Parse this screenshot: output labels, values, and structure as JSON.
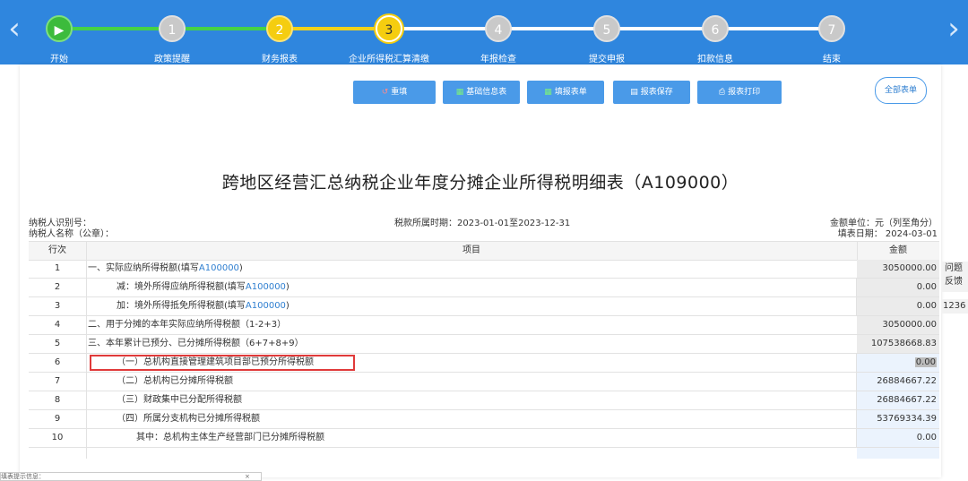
{
  "nav": {
    "prev_icon": "chevron-left-icon",
    "next_icon": "chevron-right-icon",
    "prev_glyph": "‹",
    "next_glyph": "›"
  },
  "steps": [
    {
      "label": "开始",
      "number": "▶",
      "state": "done"
    },
    {
      "label": "政策提醒",
      "number": "1",
      "state": "todo"
    },
    {
      "label": "财务报表",
      "number": "2",
      "state": "done-yellow"
    },
    {
      "label": "企业所得税汇算清缴",
      "number": "3",
      "state": "current"
    },
    {
      "label": "年报检查",
      "number": "4",
      "state": "todo"
    },
    {
      "label": "提交申报",
      "number": "5",
      "state": "todo"
    },
    {
      "label": "扣款信息",
      "number": "6",
      "state": "todo"
    },
    {
      "label": "结束",
      "number": "7",
      "state": "todo"
    }
  ],
  "toolbar": {
    "reset": {
      "icon": "↺",
      "label": "重填"
    },
    "basic_info": {
      "icon": "▦",
      "label": "基础信息表"
    },
    "fill_form": {
      "icon": "▦",
      "label": "填报表单"
    },
    "save": {
      "icon": "▤",
      "label": "报表保存"
    },
    "print": {
      "icon": "⎙",
      "label": "报表打印"
    },
    "all_forms": "全部表单"
  },
  "report": {
    "title": "跨地区经营汇总纳税企业年度分摊企业所得税明细表（A109000）",
    "taxpayer_id_label": "纳税人识别号：",
    "taxpayer_name_label": "纳税人名称（公章）：",
    "period": "税款所属时期：2023-01-01至2023-12-31",
    "unit": "金额单位：元（列至角分）",
    "fill_date": "填表日期： 2024-03-01"
  },
  "table": {
    "headers": {
      "no": "行次",
      "item": "项目",
      "amount": "金额"
    },
    "rows": [
      {
        "no": "1",
        "pre": "一、实际应纳所得税额(填写",
        "link": "A100000",
        "post": ")",
        "amount": "3050000.00"
      },
      {
        "no": "2",
        "pre": "减：境外所得应纳所得税额(填写",
        "link": "A100000",
        "post": ")",
        "amount": "0.00"
      },
      {
        "no": "3",
        "pre": "加：境外所得抵免所得税额(填写",
        "link": "A100000",
        "post": ")",
        "amount": "0.00"
      },
      {
        "no": "4",
        "pre": "二、用于分摊的本年实际应纳所得税额（1-2+3）",
        "link": "",
        "post": "",
        "amount": "3050000.00"
      },
      {
        "no": "5",
        "pre": "三、本年累计已预分、已分摊所得税额（6+7+8+9）",
        "link": "",
        "post": "",
        "amount": "107538668.83"
      },
      {
        "no": "6",
        "pre": "（一）总机构直接管理建筑项目部已预分所得税额",
        "link": "",
        "post": "",
        "amount": "0.00"
      },
      {
        "no": "7",
        "pre": "（二）总机构已分摊所得税额",
        "link": "",
        "post": "",
        "amount": "26884667.22"
      },
      {
        "no": "8",
        "pre": "（三）财政集中已分配所得税额",
        "link": "",
        "post": "",
        "amount": "26884667.22"
      },
      {
        "no": "9",
        "pre": "（四）所属分支机构已分摊所得税额",
        "link": "",
        "post": "",
        "amount": "53769334.39"
      },
      {
        "no": "10",
        "pre": "其中：总机构主体生产经营部门已分摊所得税额",
        "link": "",
        "post": "",
        "amount": "0.00"
      }
    ]
  },
  "side_panel": {
    "feedback_1": "问题",
    "feedback_2": "反馈",
    "hotline": "1236"
  },
  "bottom_tip": {
    "label": "填表提示信息：",
    "close": "×"
  },
  "colors": {
    "bar": "#2f86de",
    "done": "#3cbb3c",
    "yellow": "#f5cd10",
    "todo": "#c9c9c9",
    "link": "#2f7fd0",
    "highlight": "#e03a3a"
  }
}
